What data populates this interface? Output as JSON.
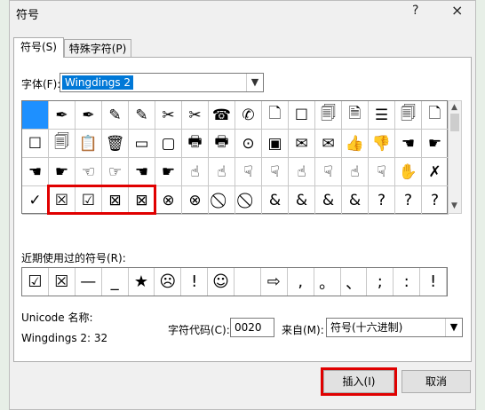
{
  "window": {
    "title": "符号",
    "help_label": "?",
    "close_label": "×"
  },
  "tabs": [
    {
      "label": "符号(S)"
    },
    {
      "label": "特殊字符(P)"
    }
  ],
  "font": {
    "label": "字体(F):",
    "value": "Wingdings 2"
  },
  "symbols": [
    {
      "g": ""
    },
    {
      "g": "✒"
    },
    {
      "g": "✒"
    },
    {
      "g": "✎"
    },
    {
      "g": "✎"
    },
    {
      "g": "✂"
    },
    {
      "g": "✂"
    },
    {
      "g": "☎"
    },
    {
      "g": "✆"
    },
    {
      "g": "🗋"
    },
    {
      "g": "☐"
    },
    {
      "g": "🗐"
    },
    {
      "g": "🗎"
    },
    {
      "g": "☰"
    },
    {
      "g": "🗐"
    },
    {
      "g": "🗋"
    },
    {
      "g": "☐"
    },
    {
      "g": "🗐"
    },
    {
      "g": "📋"
    },
    {
      "g": "🗑"
    },
    {
      "g": "▭"
    },
    {
      "g": "▢"
    },
    {
      "g": "🖶"
    },
    {
      "g": "🖶"
    },
    {
      "g": "⊙"
    },
    {
      "g": "▣"
    },
    {
      "g": "✉"
    },
    {
      "g": "✉"
    },
    {
      "g": "👍"
    },
    {
      "g": "👎"
    },
    {
      "g": "☚"
    },
    {
      "g": "☛"
    },
    {
      "g": "☚"
    },
    {
      "g": "☛"
    },
    {
      "g": "☜"
    },
    {
      "g": "☞"
    },
    {
      "g": "☚"
    },
    {
      "g": "☛"
    },
    {
      "g": "☝"
    },
    {
      "g": "☝"
    },
    {
      "g": "☟"
    },
    {
      "g": "☟"
    },
    {
      "g": "☝"
    },
    {
      "g": "☟"
    },
    {
      "g": "☝"
    },
    {
      "g": "☟"
    },
    {
      "g": "✋"
    },
    {
      "g": "✗"
    },
    {
      "g": "✓"
    },
    {
      "g": "☒"
    },
    {
      "g": "☑"
    },
    {
      "g": "⊠"
    },
    {
      "g": "⊠"
    },
    {
      "g": "⊗"
    },
    {
      "g": "⊗"
    },
    {
      "g": "⃠"
    },
    {
      "g": "⃠"
    },
    {
      "g": "&"
    },
    {
      "g": "&"
    },
    {
      "g": "&"
    },
    {
      "g": "&"
    },
    {
      "g": "?"
    },
    {
      "g": "?"
    },
    {
      "g": "?"
    }
  ],
  "recent": {
    "label": "近期使用过的符号(R):",
    "items": [
      "☑",
      "☒",
      "—",
      "_",
      "★",
      "☹",
      "!",
      "☺",
      "",
      "⇨",
      ",",
      "。",
      "、",
      ";",
      ":",
      "!"
    ]
  },
  "unicode": {
    "name_label": "Unicode 名称:",
    "name_value": "Wingdings 2: 32"
  },
  "char_code": {
    "label": "字符代码(C):",
    "value": "0020"
  },
  "from": {
    "label": "来自(M):",
    "value": "符号(十六进制)"
  },
  "buttons": {
    "insert": "插入(I)",
    "cancel": "取消"
  },
  "colors": {
    "highlight": "#e00000",
    "selection": "#1e90ff"
  }
}
